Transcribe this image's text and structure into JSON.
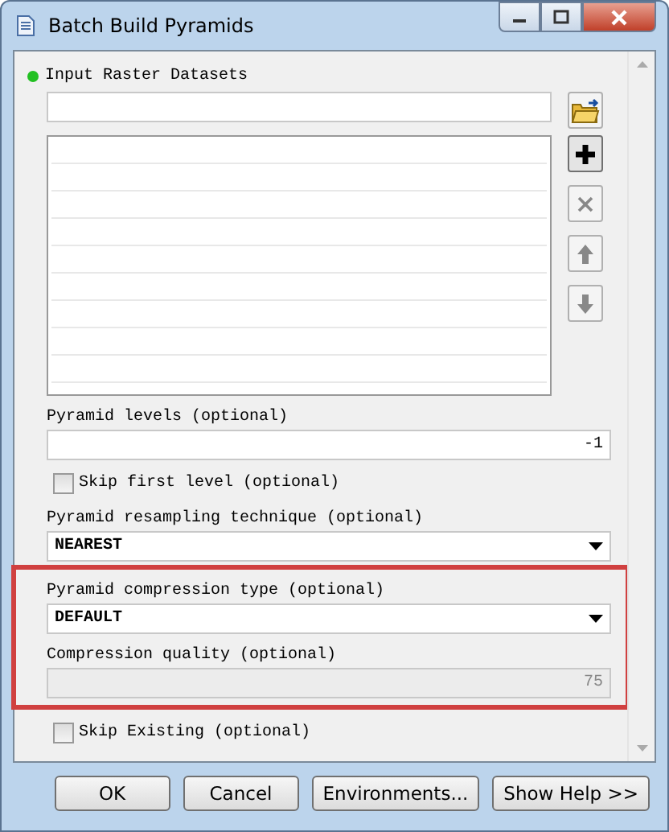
{
  "window": {
    "title": "Batch Build Pyramids"
  },
  "parameters": [
    {
      "kind": "list",
      "label": "Input Raster Datasets",
      "required": true,
      "highlighted": false
    },
    {
      "kind": "text",
      "label": "Pyramid levels (optional)",
      "value": "-1",
      "disabled": false,
      "highlighted": false
    },
    {
      "kind": "checkbox",
      "label": "Skip first level (optional)",
      "checked": false,
      "highlighted": false
    },
    {
      "kind": "dropdown",
      "label": "Pyramid resampling technique (optional)",
      "value": "NEAREST",
      "highlighted": false
    },
    {
      "kind": "dropdown",
      "label": "Pyramid compression type (optional)",
      "value": "DEFAULT",
      "highlighted": true
    },
    {
      "kind": "text",
      "label": "Compression quality (optional)",
      "value": "75",
      "disabled": true,
      "highlighted": true
    },
    {
      "kind": "checkbox",
      "label": "Skip Existing (optional)",
      "checked": false,
      "highlighted": false
    }
  ],
  "buttons": [
    "OK",
    "Cancel",
    "Environments...",
    "Show Help >>"
  ]
}
